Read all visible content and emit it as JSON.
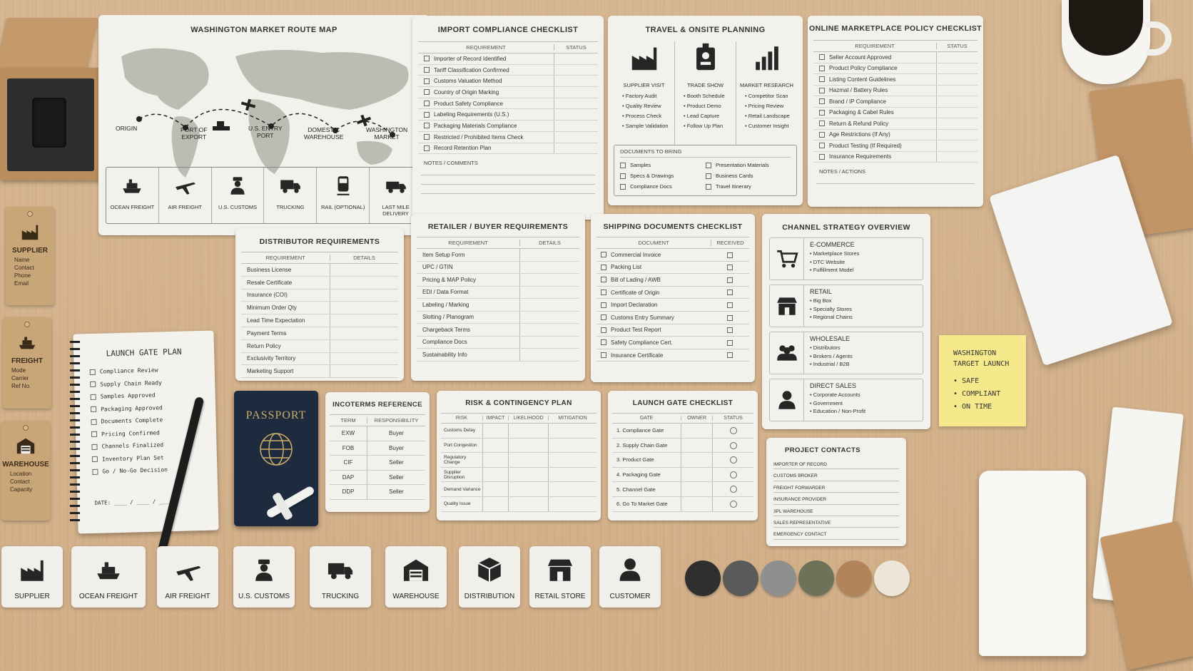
{
  "route_map": {
    "title": "WASHINGTON MARKET ROUTE MAP",
    "stops": [
      "ORIGIN",
      "PORT OF\nEXPORT",
      "U.S. ENTRY\nPORT",
      "DOMESTIC\nWAREHOUSE",
      "WASHINGTON\nMARKET"
    ],
    "modes": [
      {
        "label": "OCEAN FREIGHT",
        "icon": "ship-icon"
      },
      {
        "label": "AIR FREIGHT",
        "icon": "plane-icon"
      },
      {
        "label": "U.S. CUSTOMS",
        "icon": "customs-officer-icon"
      },
      {
        "label": "TRUCKING",
        "icon": "truck-icon"
      },
      {
        "label": "RAIL (OPTIONAL)",
        "icon": "train-icon"
      },
      {
        "label": "LAST MILE\nDELIVERY",
        "icon": "delivery-van-icon"
      }
    ]
  },
  "import_compliance": {
    "title": "IMPORT COMPLIANCE CHECKLIST",
    "col_requirement": "REQUIREMENT",
    "col_status": "STATUS",
    "items": [
      "Importer of Record Identified",
      "Tariff Classification Confirmed",
      "Customs Valuation Method",
      "Country of Origin Marking",
      "Product Safety Compliance",
      "Labeling Requirements (U.S.)",
      "Packaging Materials Compliance",
      "Restricted / Prohibited Items Check",
      "Record Retention Plan"
    ],
    "notes_label": "NOTES / COMMENTS"
  },
  "travel": {
    "title": "TRAVEL & ONSITE PLANNING",
    "columns": [
      {
        "heading": "SUPPLIER VISIT",
        "icon": "factory-icon",
        "items": [
          "Factory Audit",
          "Quality Review",
          "Process Check",
          "Sample Validation"
        ]
      },
      {
        "heading": "TRADE SHOW",
        "icon": "badge-icon",
        "items": [
          "Booth Schedule",
          "Product Demo",
          "Lead Capture",
          "Follow Up Plan"
        ]
      },
      {
        "heading": "MARKET RESEARCH",
        "icon": "bar-chart-icon",
        "items": [
          "Competitor Scan",
          "Pricing Review",
          "Retail Landscape",
          "Customer Insight"
        ]
      }
    ],
    "docs_label": "DOCUMENTS TO BRING",
    "docs_left": [
      "Samples",
      "Specs & Drawings",
      "Compliance Docs"
    ],
    "docs_right": [
      "Presentation Materials",
      "Business Cards",
      "Travel Itinerary"
    ]
  },
  "marketplace": {
    "title": "ONLINE MARKETPLACE POLICY CHECKLIST",
    "col_requirement": "REQUIREMENT",
    "col_status": "STATUS",
    "items": [
      "Seller Account Approved",
      "Product Policy Compliance",
      "Listing Content Guidelines",
      "Hazmat / Battery Rules",
      "Brand / IP Compliance",
      "Packaging & Cabel Rules",
      "Return & Refund Policy",
      "Age Restrictions (If Any)",
      "Product Testing (If Required)",
      "Insurance Requirements"
    ],
    "notes_label": "NOTES / ACTIONS"
  },
  "distributor": {
    "title": "DISTRIBUTOR REQUIREMENTS",
    "col_requirement": "REQUIREMENT",
    "col_details": "DETAILS",
    "items": [
      "Business License",
      "Resale Certificate",
      "Insurance (COI)",
      "Minimum Order Qty",
      "Lead Time Expectation",
      "Payment Terms",
      "Return Policy",
      "Exclusivity Territory",
      "Marketing Support"
    ]
  },
  "retailer": {
    "title": "RETAILER / BUYER REQUIREMENTS",
    "col_requirement": "REQUIREMENT",
    "col_details": "DETAILS",
    "items": [
      "Item Setup Form",
      "UPC / GTIN",
      "Pricing & MAP Policy",
      "EDI / Data Format",
      "Labeling / Marking",
      "Slotting / Planogram",
      "Chargeback Terms",
      "Compliance Docs",
      "Sustainability Info"
    ]
  },
  "shipping_docs": {
    "title": "SHIPPING DOCUMENTS CHECKLIST",
    "col_document": "DOCUMENT",
    "col_received": "RECEIVED",
    "items": [
      "Commercial Invoice",
      "Packing List",
      "Bill of Lading / AWB",
      "Certificate of Origin",
      "Import Declaration",
      "Customs Entry Summary",
      "Product Test Report",
      "Safety Compliance Cert.",
      "Insurance Certificate"
    ]
  },
  "channel": {
    "title": "CHANNEL STRATEGY OVERVIEW",
    "blocks": [
      {
        "heading": "E-COMMERCE",
        "icon": "cart-icon",
        "items": [
          "Marketplace Stores",
          "DTC Website",
          "Fulfillment Model"
        ]
      },
      {
        "heading": "RETAIL",
        "icon": "storefront-icon",
        "items": [
          "Big Box",
          "Specialty Stores",
          "Regional Chains"
        ]
      },
      {
        "heading": "WHOLESALE",
        "icon": "people-group-icon",
        "items": [
          "Distributors",
          "Brokers / Agents",
          "Industrial / B2B"
        ]
      },
      {
        "heading": "DIRECT SALES",
        "icon": "person-icon",
        "items": [
          "Corporate Accounts",
          "Government",
          "Education / Non-Profit"
        ]
      }
    ]
  },
  "sticky_note": {
    "heading": "WASHINGTON\nTARGET LAUNCH",
    "items": [
      "SAFE",
      "COMPLIANT",
      "ON TIME"
    ]
  },
  "tags": [
    {
      "title": "SUPPLIER",
      "icon": "factory-icon",
      "fields": [
        "Name",
        "Contact",
        "Phone",
        "Email"
      ]
    },
    {
      "title": "FREIGHT",
      "icon": "ship-icon",
      "fields": [
        "Mode",
        "Carrier",
        "Ref No."
      ]
    },
    {
      "title": "WAREHOUSE",
      "icon": "warehouse-icon",
      "fields": [
        "Location",
        "Contact",
        "Capacity"
      ]
    }
  ],
  "notebook": {
    "title": "LAUNCH GATE PLAN",
    "items": [
      "Compliance Review",
      "Supply Chain Ready",
      "Samples Approved",
      "Packaging Approved",
      "Documents Complete",
      "Pricing Confirmed",
      "Channels Finalized",
      "Inventory Plan Set",
      "Go / No-Go Decision"
    ],
    "date_label": "DATE: ____ / ____ / ____"
  },
  "passport": {
    "label": "PASSPORT"
  },
  "incoterms": {
    "title": "INCOTERMS REFERENCE",
    "col_term": "TERM",
    "col_resp": "RESPONSIBILITY",
    "rows": [
      [
        "EXW",
        "Buyer"
      ],
      [
        "FOB",
        "Buyer"
      ],
      [
        "CIF",
        "Seller"
      ],
      [
        "DAP",
        "Seller"
      ],
      [
        "DDP",
        "Seller"
      ]
    ]
  },
  "risk": {
    "title": "RISK & CONTINGENCY PLAN",
    "cols": [
      "RISK",
      "IMPACT",
      "LIKELIHOOD",
      "MITIGATION"
    ],
    "items": [
      "Customs Delay",
      "Port Congestion",
      "Regulatory Change",
      "Supplier Disruption",
      "Demand Variance",
      "Quality Issue"
    ]
  },
  "launch_checklist": {
    "title": "LAUNCH GATE CHECKLIST",
    "cols": [
      "GATE",
      "OWNER",
      "STATUS"
    ],
    "items": [
      "1. Compliance Gate",
      "2. Supply Chain Gate",
      "3. Product Gate",
      "4. Packaging Gate",
      "5. Channel Gate",
      "6. Go To Market Gate"
    ]
  },
  "contacts": {
    "title": "PROJECT CONTACTS",
    "items": [
      "IMPORTER OF RECORD",
      "CUSTOMS BROKER",
      "FREIGHT FORWARDER",
      "INSURANCE PROVIDER",
      "3PL WAREHOUSE",
      "SALES REPRESENTATIVE",
      "EMERGENCY CONTACT"
    ]
  },
  "tiles": [
    {
      "label": "SUPPLIER",
      "icon": "factory-icon"
    },
    {
      "label": "OCEAN FREIGHT",
      "icon": "ship-icon"
    },
    {
      "label": "AIR FREIGHT",
      "icon": "plane-icon"
    },
    {
      "label": "U.S. CUSTOMS",
      "icon": "customs-officer-icon"
    },
    {
      "label": "TRUCKING",
      "icon": "truck-icon"
    },
    {
      "label": "WAREHOUSE",
      "icon": "warehouse-icon"
    },
    {
      "label": "DISTRIBUTION",
      "icon": "box-icon"
    },
    {
      "label": "RETAIL STORE",
      "icon": "storefront-icon"
    },
    {
      "label": "CUSTOMER",
      "icon": "person-icon"
    }
  ],
  "swatches": [
    "#2f2f2f",
    "#5a5a5a",
    "#8f8f8f",
    "#6d7258",
    "#b3845a",
    "#ede6d8"
  ]
}
